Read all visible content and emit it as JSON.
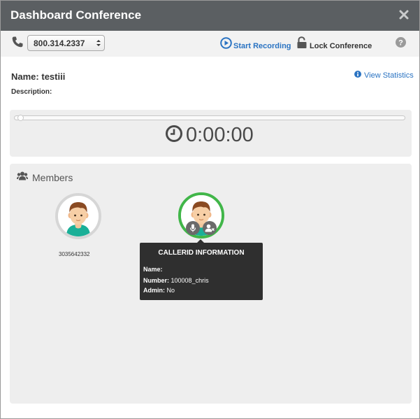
{
  "window": {
    "title": "Dashboard Conference"
  },
  "toolbar": {
    "did_value": "800.314.2337",
    "start_recording": "Start Recording",
    "lock_conference": "Lock Conference"
  },
  "conference": {
    "name_label": "Name:",
    "name_value": "testiii",
    "description_label": "Description:",
    "view_statistics": "View Statistics"
  },
  "timer": {
    "elapsed": "0:00:00",
    "progress": 0
  },
  "members": {
    "title": "Members",
    "list": [
      {
        "number": "3035642332",
        "status": "idle"
      },
      {
        "number": "",
        "status": "active"
      }
    ]
  },
  "tooltip": {
    "title": "CALLERID INFORMATION",
    "name_label": "Name:",
    "name_value": "",
    "number_label": "Number:",
    "number_value": "100008_chris",
    "admin_label": "Admin:",
    "admin_value": "No"
  },
  "colors": {
    "titlebar": "#5b5f62",
    "link": "#2a73c2",
    "active_ring": "#41b649",
    "panel": "#eeeeee"
  },
  "icons": [
    "close-icon",
    "phone-icon",
    "play-circle-icon",
    "unlock-icon",
    "help-icon",
    "info-icon",
    "clock-icon",
    "users-icon",
    "microphone-icon",
    "user-remove-icon"
  ]
}
